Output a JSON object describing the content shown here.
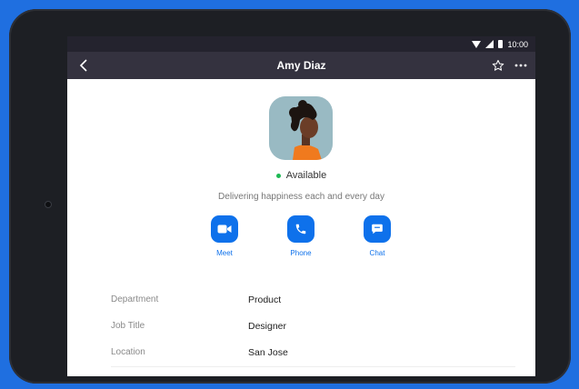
{
  "status_bar": {
    "time": "10:00"
  },
  "header": {
    "title": "Amy Diaz"
  },
  "profile": {
    "presence": "Available",
    "status_message": "Delivering happiness each and every day"
  },
  "actions": [
    {
      "label": "Meet",
      "icon": "video-camera-icon"
    },
    {
      "label": "Phone",
      "icon": "phone-icon"
    },
    {
      "label": "Chat",
      "icon": "chat-bubble-icon"
    }
  ],
  "details": [
    {
      "label": "Department",
      "value": "Product"
    },
    {
      "label": "Job Title",
      "value": "Designer"
    },
    {
      "label": "Location",
      "value": "San Jose"
    }
  ],
  "colors": {
    "accent": "#0e71eb",
    "app_bar": "#34323f",
    "status_bar": "#24232e",
    "presence_available": "#1db954",
    "background": "#1f6fe0"
  }
}
